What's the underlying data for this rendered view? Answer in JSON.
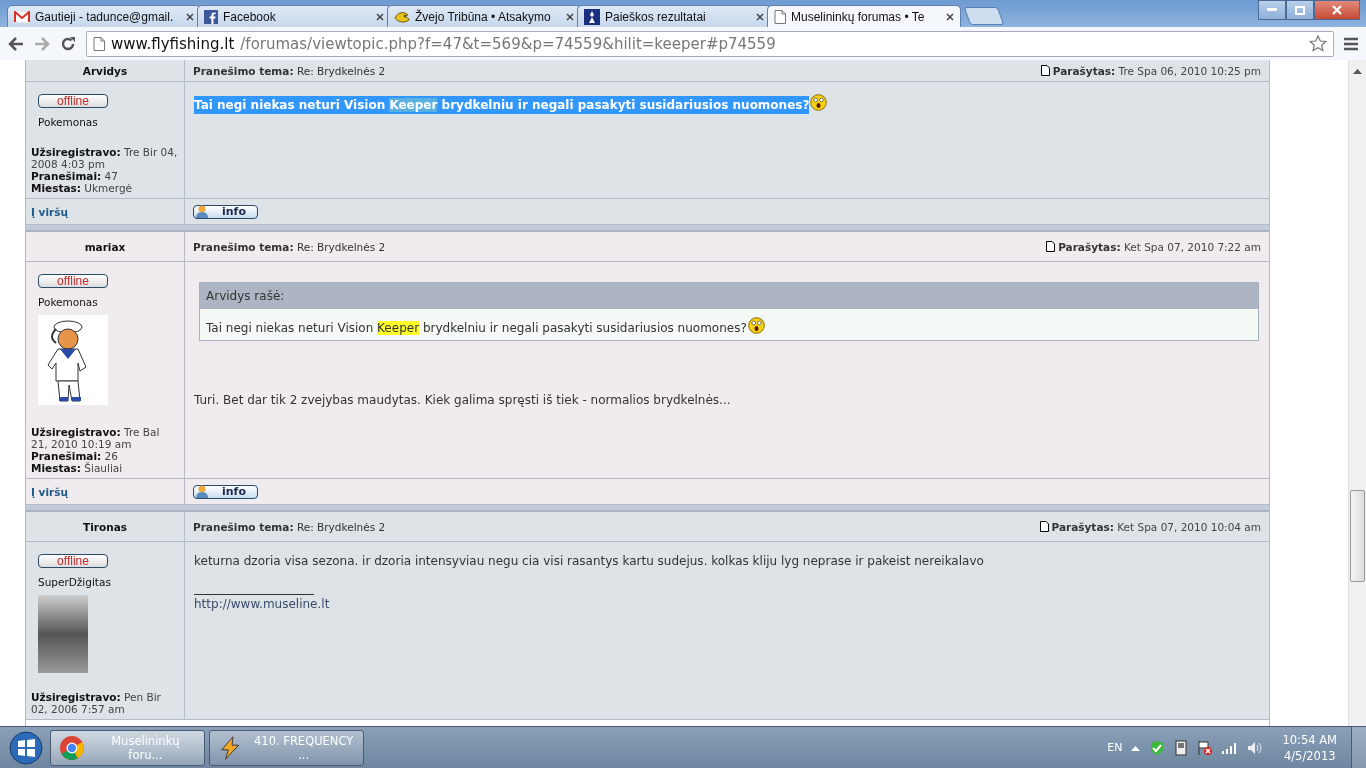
{
  "browser": {
    "tabs": [
      {
        "title": "Gautieji - tadunce@gmail.",
        "selected": false
      },
      {
        "title": "Facebook",
        "selected": false
      },
      {
        "title": "Žvejo Tribūna • Atsakymo",
        "selected": false
      },
      {
        "title": "Paieškos rezultatai",
        "selected": false
      },
      {
        "title": "Muselininkų forumas • Te",
        "selected": true
      }
    ],
    "url": {
      "host": "www.flyfishing.lt",
      "path": "/forumas/viewtopic.php?f=47&t=569&p=74559&hilit=keeper#p74559"
    }
  },
  "posts": [
    {
      "author": "Arvidys",
      "status": "offline",
      "rank": "Pokemonas",
      "details": [
        "**Užsiregistravo:** Tre Bir 04, 2008 4:03 pm",
        "**Pranešimai:** 47",
        "**Miestas:** Ukmergė"
      ],
      "subject": "**Pranešimo tema:** Re: Brydkelnės 2",
      "posted": "**Parašytas:** Tre Spa 06, 2010 10:25 pm",
      "content": [
        {
          "kind": "paragraph",
          "selected": true,
          "smiley": true,
          "parts": [
            {
              "text": "Tai negi niekas neturi Vision ",
              "highlight": false
            },
            {
              "text": "Keeper",
              "highlight": true
            },
            {
              "text": " brydkelniu ir negali pasakyti susidariusios nuomones?",
              "highlight": false
            }
          ]
        }
      ],
      "top_link": "Į viršų",
      "info_button": "info"
    },
    {
      "author": "mariax",
      "status": "offline",
      "rank": "Pokemonas",
      "details": [
        "**Užsiregistravo:** Tre Bal 21, 2010 10:19 am",
        "**Pranešimai:** 26",
        "**Miestas:** Šiauliai"
      ],
      "subject": "**Pranešimo tema:** Re: Brydkelnės 2",
      "posted": "**Parašytas:** Ket Spa 07, 2010 7:22 am",
      "content": [
        {
          "kind": "quote",
          "author": "Arvidys rašė:",
          "smiley": true,
          "parts": [
            {
              "text": "Tai negi niekas neturi Vision ",
              "highlight": false
            },
            {
              "text": "Keeper",
              "highlight": true
            },
            {
              "text": " brydkelniu ir negali pasakyti susidariusios nuomones?",
              "highlight": false
            }
          ]
        },
        {
          "kind": "paragraph",
          "selected": false,
          "parts": [
            {
              "text": "Turi. Bet dar tik 2 zvejybas maudytas. Kiek galima spręsti iš tiek - normalios brydkelnės...",
              "highlight": false
            }
          ]
        }
      ],
      "top_link": "Į viršų",
      "info_button": "info"
    },
    {
      "author": "Tironas",
      "status": "offline",
      "rank": "SuperDžigitas",
      "details": [
        "**Užsiregistravo:** Pen Bir 02, 2006 7:57 am"
      ],
      "subject": "**Pranešimo tema:** Re: Brydkelnės 2",
      "posted": "**Parašytas:** Ket Spa 07, 2010 10:04 am",
      "content": [
        {
          "kind": "paragraph",
          "selected": false,
          "parts": [
            {
              "text": "keturna dzoria visa sezona. ir dzoria intensyviau negu cia visi rasantys kartu sudejus. kolkas kliju lyg neprase ir pakeist nereikalavo",
              "highlight": false
            }
          ]
        },
        {
          "kind": "signature",
          "text": "http://www.museline.lt"
        }
      ]
    }
  ],
  "taskbar": {
    "items": [
      {
        "label": "Muselininkų foru...",
        "selected": true
      },
      {
        "label": "410. FREQUENCY ...",
        "selected": false
      }
    ],
    "language": "EN",
    "time": "10:54 AM",
    "date": "4/5/2013"
  }
}
